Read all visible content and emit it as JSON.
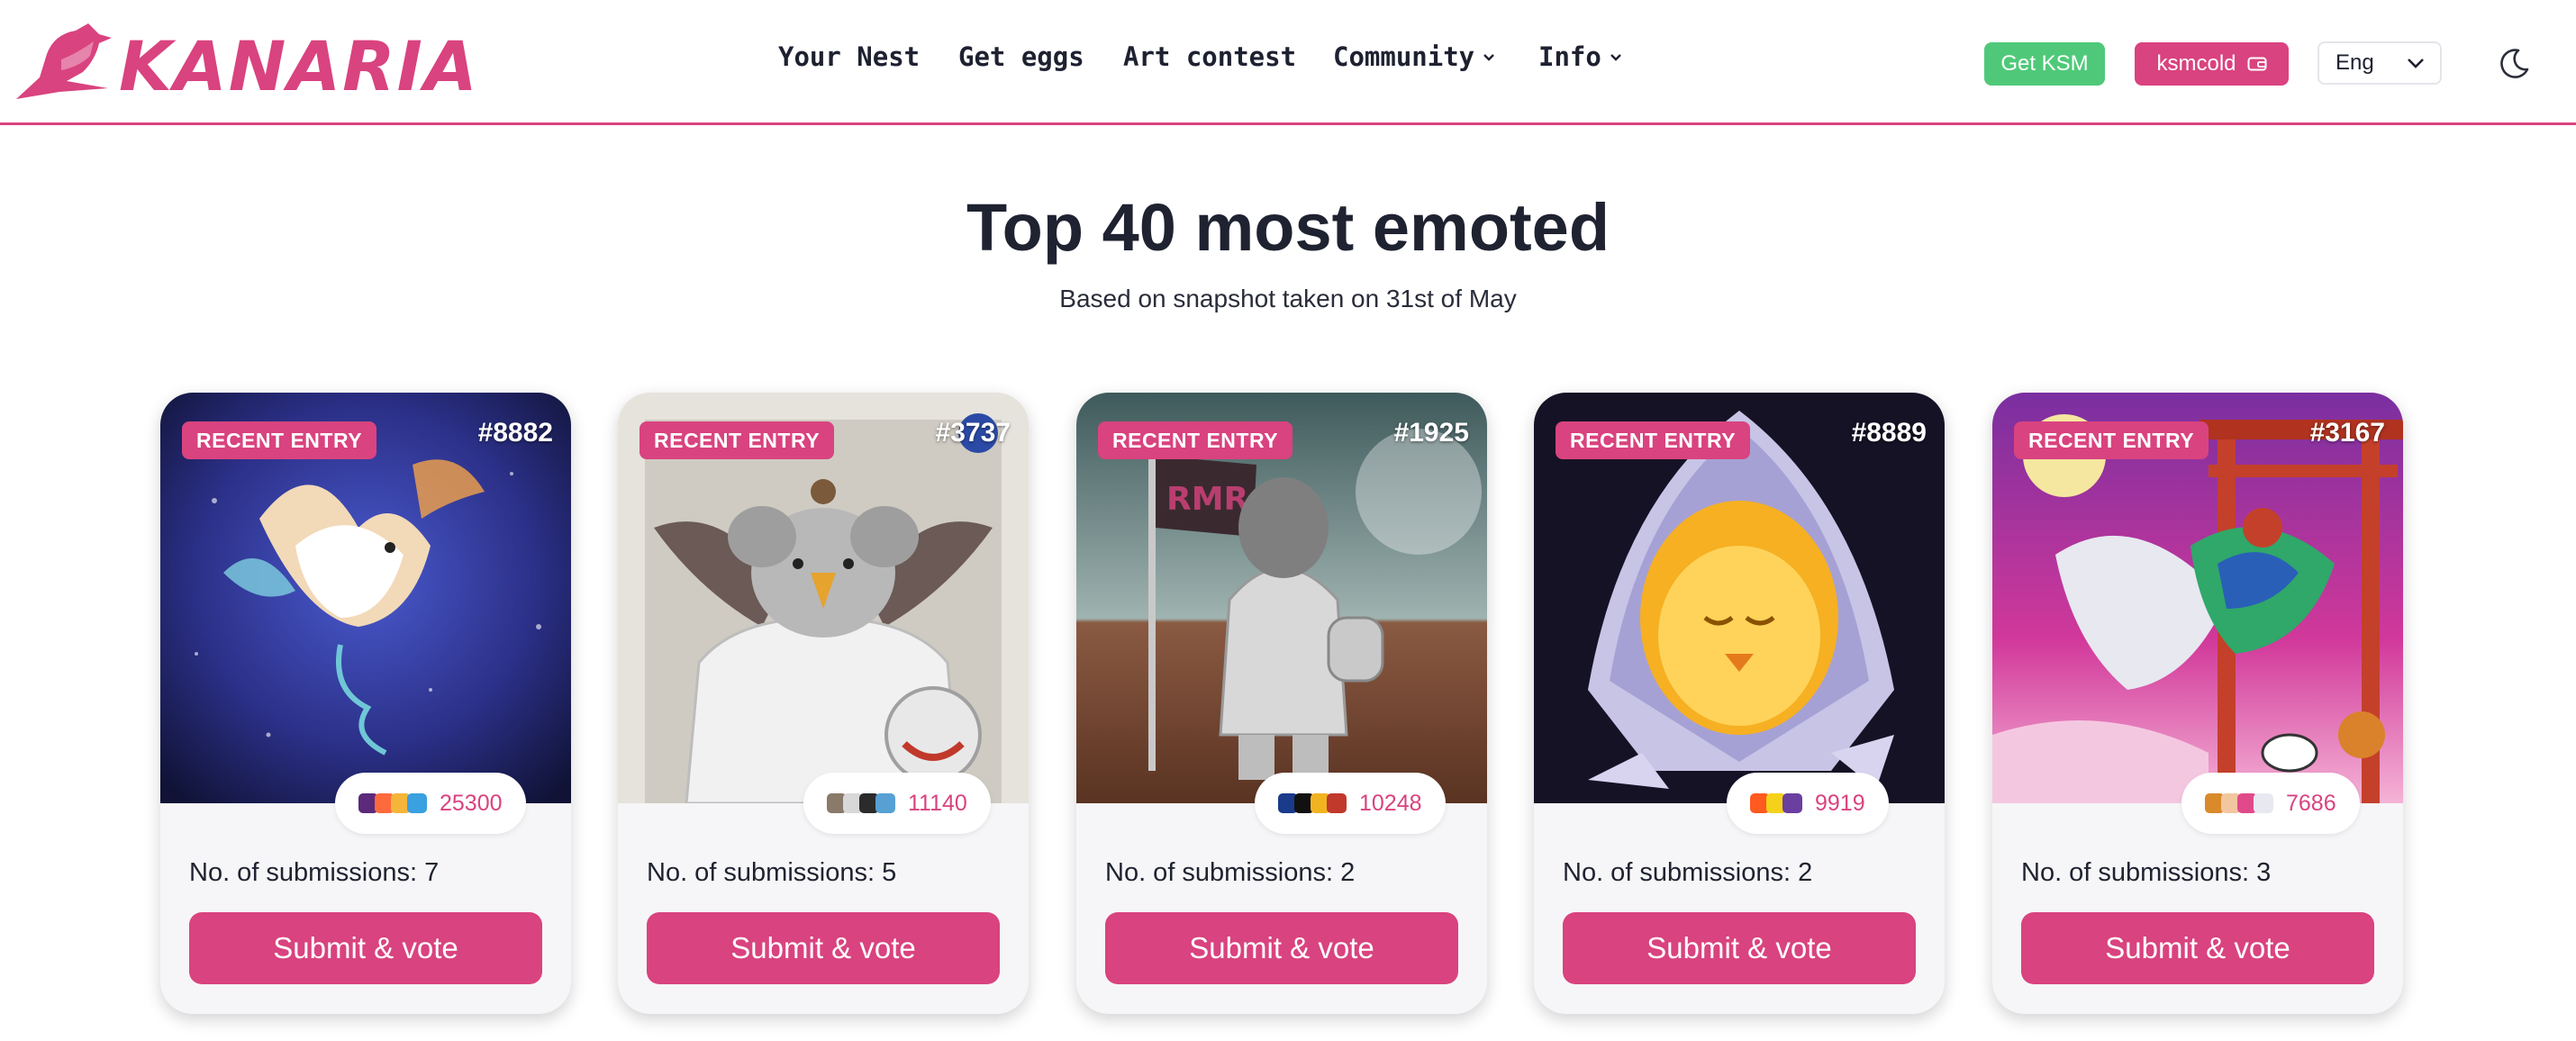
{
  "header": {
    "brand": "KANARIA",
    "nav": [
      {
        "label": "Your Nest",
        "has_dropdown": false
      },
      {
        "label": "Get eggs",
        "has_dropdown": false
      },
      {
        "label": "Art contest",
        "has_dropdown": false
      },
      {
        "label": "Community",
        "has_dropdown": true
      },
      {
        "label": "Info",
        "has_dropdown": true
      }
    ],
    "get_ksm_label": "Get KSM",
    "wallet_label": "ksmcold",
    "language": "Eng"
  },
  "main": {
    "title": "Top 40 most emoted",
    "subtitle": "Based on snapshot taken on 31st of May"
  },
  "cards": [
    {
      "badge": "RECENT ENTRY",
      "id": "#8882",
      "emote_count": "25300",
      "submissions_label": "No. of submissions: 7",
      "button": "Submit & vote"
    },
    {
      "badge": "RECENT ENTRY",
      "id": "#3737",
      "emote_count": "11140",
      "submissions_label": "No. of submissions: 5",
      "button": "Submit & vote"
    },
    {
      "badge": "RECENT ENTRY",
      "id": "#1925",
      "emote_count": "10248",
      "submissions_label": "No. of submissions: 2",
      "button": "Submit & vote"
    },
    {
      "badge": "RECENT ENTRY",
      "id": "#8889",
      "emote_count": "9919",
      "submissions_label": "No. of submissions: 2",
      "button": "Submit & vote"
    },
    {
      "badge": "RECENT ENTRY",
      "id": "#3167",
      "emote_count": "7686",
      "submissions_label": "No. of submissions: 3",
      "button": "Submit & vote"
    }
  ],
  "colors": {
    "accent": "#d9437f",
    "ksm_green": "#4fc979",
    "text": "#1f2230",
    "card_bg": "#f6f6f8"
  }
}
